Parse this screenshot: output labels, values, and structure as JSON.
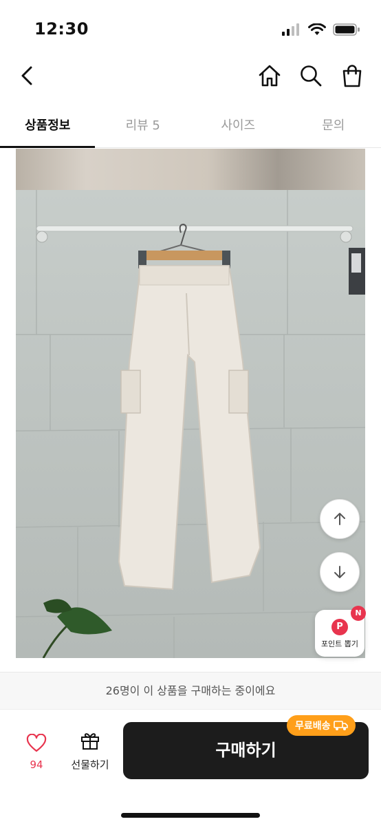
{
  "status": {
    "time": "12:30"
  },
  "tabs": [
    {
      "label": "상품정보",
      "active": true
    },
    {
      "label": "리뷰 5",
      "active": false
    },
    {
      "label": "사이즈",
      "active": false
    },
    {
      "label": "문의",
      "active": false
    }
  ],
  "floating": {
    "point_label": "포인트 뽑기",
    "point_badge": "N",
    "point_icon": "P"
  },
  "notice": "26명이 이 상품을 구매하는 중이에요",
  "footer": {
    "like_count": "94",
    "gift_label": "선물하기",
    "buy_label": "구매하기",
    "free_shipping": "무료배송"
  },
  "colors": {
    "accent_red": "#e8344e",
    "buy_button": "#1c1c1c",
    "free_shipping_badge": "#ff9f1a"
  }
}
